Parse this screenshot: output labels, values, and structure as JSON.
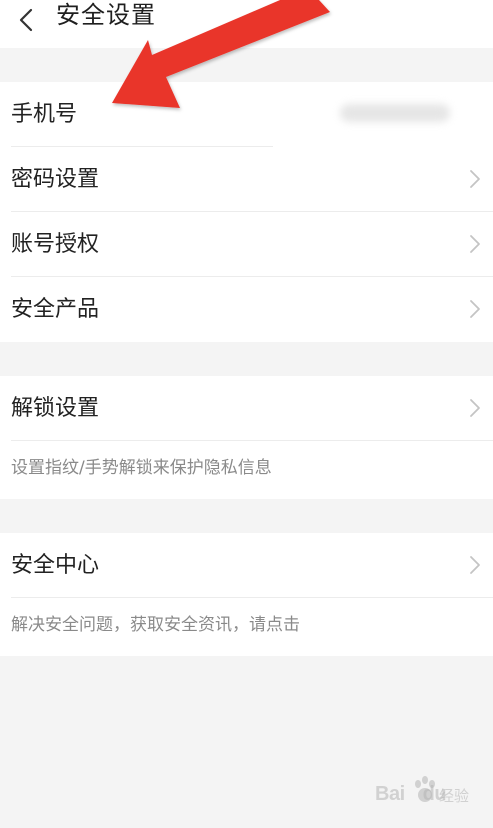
{
  "header": {
    "title": "安全设置",
    "back_icon": "chevron-left-icon"
  },
  "account_group": {
    "items": [
      {
        "label": "手机号"
      },
      {
        "label": "密码设置"
      },
      {
        "label": "账号授权"
      },
      {
        "label": "安全产品"
      }
    ]
  },
  "unlock_group": {
    "item": {
      "label": "解锁设置"
    },
    "description": "设置指纹/手势解锁来保护隐私信息"
  },
  "security_center_group": {
    "item": {
      "label": "安全中心"
    },
    "description": "解决安全问题，获取安全资讯，请点击"
  },
  "colors": {
    "background": "#f4f4f4",
    "panel": "#ffffff",
    "annotation_arrow": "#e9342b",
    "chevron": "#c4c4c4",
    "description_text": "#8a8a8a"
  },
  "watermark": {
    "text_left": "Bai",
    "text_right": "du",
    "sub": "经验"
  }
}
